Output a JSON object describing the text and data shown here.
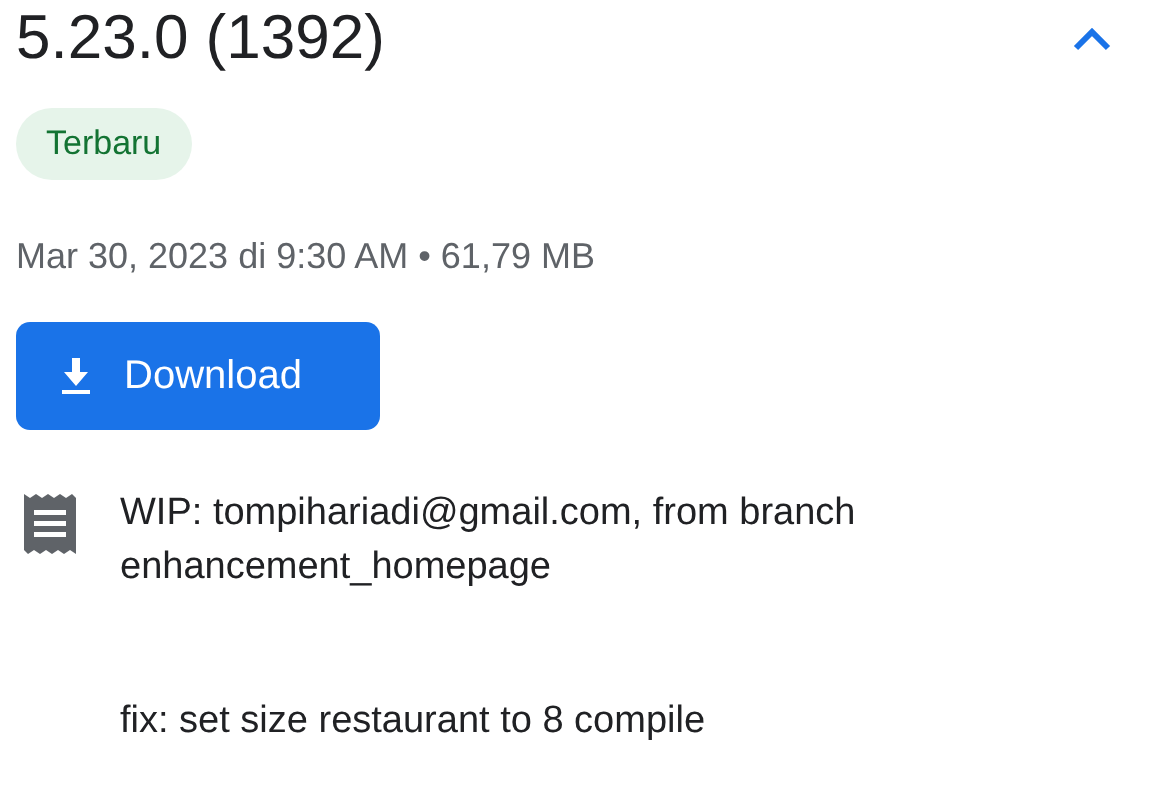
{
  "version": {
    "title": "5.23.0 (1392)",
    "expanded": true
  },
  "badge": "Terbaru",
  "meta": "Mar 30, 2023 di 9:30 AM • 61,79 MB",
  "download_button": "Download",
  "notes": [
    "WIP: tompihariadi@gmail.com, from branch enhancement_homepage",
    "fix: set size restaurant to 8 compile"
  ]
}
